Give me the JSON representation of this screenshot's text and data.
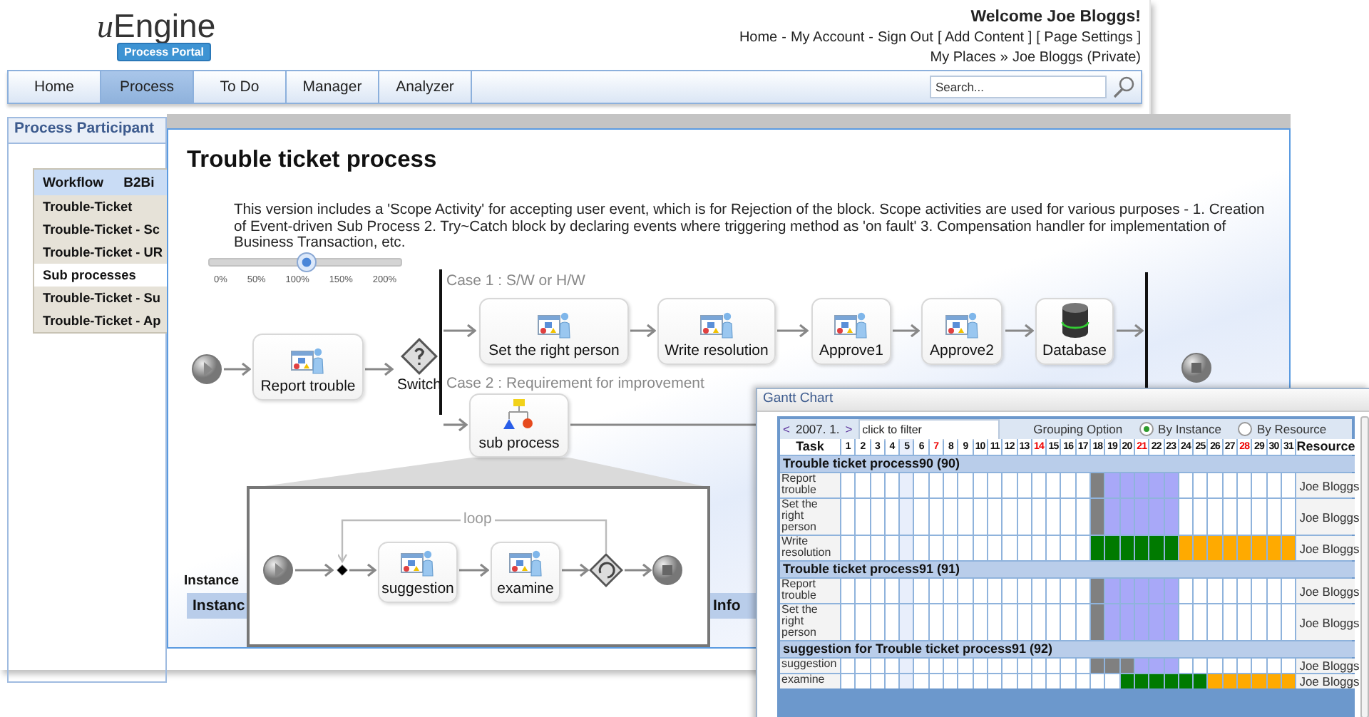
{
  "portal": {
    "logo": {
      "mark": "u",
      "name": "Engine",
      "badge": "Process Portal"
    },
    "welcome": "Welcome Joe Bloggs!",
    "links": [
      {
        "label": "Home",
        "separator": "-"
      },
      {
        "label": "My Account",
        "separator": "-"
      },
      {
        "label": "Sign Out"
      },
      {
        "label": "[ Add Content ]"
      },
      {
        "label": "[ Page Settings ]"
      }
    ],
    "breadcrumb": {
      "items": [
        "My Places",
        "Joe Bloggs (Private)"
      ],
      "separator": "»"
    },
    "nav": [
      {
        "label": "Home",
        "selected": false
      },
      {
        "label": "Process",
        "selected": true
      },
      {
        "label": "To Do",
        "selected": false
      },
      {
        "label": "Manager",
        "selected": false
      },
      {
        "label": "Analyzer",
        "selected": false
      }
    ],
    "search": {
      "placeholder": "Search..."
    },
    "panel": {
      "title": "Process Participant",
      "columns": [
        "Workflow",
        "B2Bi"
      ],
      "items": [
        {
          "label": "Trouble-Ticket",
          "kind": "item"
        },
        {
          "label": "Trouble-Ticket - Sc",
          "kind": "item"
        },
        {
          "label": "Trouble-Ticket - UR",
          "kind": "item"
        },
        {
          "label": "Sub processes",
          "kind": "group"
        },
        {
          "label": "Trouble-Ticket - Su",
          "kind": "item"
        },
        {
          "label": "Trouble-Ticket - Ap",
          "kind": "item"
        }
      ]
    }
  },
  "process": {
    "title": "Trouble ticket process",
    "description": "This version includes a 'Scope Activity' for accepting user event, which is for Rejection of the block. Scope activities are used for various purposes - 1. Creation of Event-driven Sub Process 2. Try~Catch block by declaring events where triggering method as 'on fault' 3. Compensation handler for implementation of Business Transaction, etc.",
    "zoom": {
      "level": 0.5,
      "marks": [
        "0%",
        "50%",
        "100%",
        "150%",
        "200%"
      ]
    },
    "cases": [
      "Case 1 : S/W or H/W",
      "Case 2 : Requirement for improvement"
    ],
    "nodes": [
      {
        "kind": "start"
      },
      {
        "kind": "task",
        "label": "Report trouble"
      },
      {
        "kind": "switch",
        "label": "Switch"
      },
      {
        "kind": "task",
        "label": "Set the right person"
      },
      {
        "kind": "task",
        "label": "Write resolution"
      },
      {
        "kind": "task",
        "label": "Approve1"
      },
      {
        "kind": "task",
        "label": "Approve2"
      },
      {
        "kind": "database",
        "label": "Database"
      },
      {
        "kind": "end"
      },
      {
        "kind": "subprocess",
        "label": "sub process"
      }
    ],
    "subprocess": {
      "loop": "loop",
      "nodes": [
        {
          "kind": "start"
        },
        {
          "kind": "join"
        },
        {
          "kind": "task",
          "label": "suggestion"
        },
        {
          "kind": "task",
          "label": "examine"
        },
        {
          "kind": "loop"
        },
        {
          "kind": "end"
        }
      ]
    },
    "instances": {
      "title": "Instance",
      "columns": [
        "Instanc",
        "Info"
      ]
    }
  },
  "gantt": {
    "title": "Gantt Chart",
    "prev": "<",
    "month": "2007. 1.",
    "next": ">",
    "filter": {
      "placeholder": "click to filter"
    },
    "grouping": {
      "label": "Grouping Option",
      "options": [
        {
          "label": "By Instance",
          "selected": true
        },
        {
          "label": "By Resource",
          "selected": false
        }
      ]
    },
    "task_header": "Task",
    "resource_header": "Resource",
    "days": [
      {
        "label": "1",
        "holiday": false,
        "today": false
      },
      {
        "label": "2",
        "holiday": false,
        "today": false
      },
      {
        "label": "3",
        "holiday": false,
        "today": false
      },
      {
        "label": "4",
        "holiday": false,
        "today": false
      },
      {
        "label": "5",
        "holiday": false,
        "today": true
      },
      {
        "label": "6",
        "holiday": false,
        "today": false
      },
      {
        "label": "7",
        "holiday": true,
        "today": false
      },
      {
        "label": "8",
        "holiday": false,
        "today": false
      },
      {
        "label": "9",
        "holiday": false,
        "today": false
      },
      {
        "label": "10",
        "holiday": false,
        "today": false
      },
      {
        "label": "11",
        "holiday": false,
        "today": false
      },
      {
        "label": "12",
        "holiday": false,
        "today": false
      },
      {
        "label": "13",
        "holiday": false,
        "today": false
      },
      {
        "label": "14",
        "holiday": true,
        "today": false
      },
      {
        "label": "15",
        "holiday": false,
        "today": false
      },
      {
        "label": "16",
        "holiday": false,
        "today": false
      },
      {
        "label": "17",
        "holiday": false,
        "today": false
      },
      {
        "label": "18",
        "holiday": false,
        "today": false
      },
      {
        "label": "19",
        "holiday": false,
        "today": false
      },
      {
        "label": "20",
        "holiday": false,
        "today": false
      },
      {
        "label": "21",
        "holiday": true,
        "today": false
      },
      {
        "label": "22",
        "holiday": false,
        "today": false
      },
      {
        "label": "23",
        "holiday": false,
        "today": false
      },
      {
        "label": "24",
        "holiday": false,
        "today": false
      },
      {
        "label": "25",
        "holiday": false,
        "today": false
      },
      {
        "label": "26",
        "holiday": false,
        "today": false
      },
      {
        "label": "27",
        "holiday": false,
        "today": false
      },
      {
        "label": "28",
        "holiday": true,
        "today": false
      },
      {
        "label": "29",
        "holiday": false,
        "today": false
      },
      {
        "label": "30",
        "holiday": false,
        "today": false
      },
      {
        "label": "31",
        "holiday": false,
        "today": false
      }
    ],
    "groups": [
      {
        "title": "Trouble ticket process90 (90)",
        "tasks": [
          {
            "name": "Report trouble",
            "cells": [
              {
                "kind": "empty"
              },
              {
                "kind": "empty"
              },
              {
                "kind": "empty"
              },
              {
                "kind": "empty"
              },
              {
                "kind": "empty"
              },
              {
                "kind": "empty"
              },
              {
                "kind": "empty"
              },
              {
                "kind": "empty"
              },
              {
                "kind": "empty"
              },
              {
                "kind": "empty"
              },
              {
                "kind": "empty"
              },
              {
                "kind": "empty"
              },
              {
                "kind": "empty"
              },
              {
                "kind": "empty"
              },
              {
                "kind": "empty"
              },
              {
                "kind": "empty"
              },
              {
                "kind": "empty"
              },
              {
                "kind": "bar",
                "color": "#808080"
              },
              {
                "kind": "bar",
                "color": "#a8a8f8"
              },
              {
                "kind": "bar",
                "color": "#a8a8f8"
              },
              {
                "kind": "bar",
                "color": "#a8a8f8"
              },
              {
                "kind": "bar",
                "color": "#a8a8f8"
              },
              {
                "kind": "bar",
                "color": "#a8a8f8"
              },
              {
                "kind": "empty"
              },
              {
                "kind": "empty"
              },
              {
                "kind": "empty"
              },
              {
                "kind": "empty"
              },
              {
                "kind": "empty"
              },
              {
                "kind": "empty"
              },
              {
                "kind": "empty"
              },
              {
                "kind": "empty"
              }
            ],
            "resource": "Joe Bloggs"
          },
          {
            "name": "Set the right person",
            "cells": [
              {
                "kind": "empty"
              },
              {
                "kind": "empty"
              },
              {
                "kind": "empty"
              },
              {
                "kind": "empty"
              },
              {
                "kind": "empty"
              },
              {
                "kind": "empty"
              },
              {
                "kind": "empty"
              },
              {
                "kind": "empty"
              },
              {
                "kind": "empty"
              },
              {
                "kind": "empty"
              },
              {
                "kind": "empty"
              },
              {
                "kind": "empty"
              },
              {
                "kind": "empty"
              },
              {
                "kind": "empty"
              },
              {
                "kind": "empty"
              },
              {
                "kind": "empty"
              },
              {
                "kind": "empty"
              },
              {
                "kind": "bar",
                "color": "#808080"
              },
              {
                "kind": "bar",
                "color": "#a8a8f8"
              },
              {
                "kind": "bar",
                "color": "#a8a8f8"
              },
              {
                "kind": "bar",
                "color": "#a8a8f8"
              },
              {
                "kind": "bar",
                "color": "#a8a8f8"
              },
              {
                "kind": "bar",
                "color": "#a8a8f8"
              },
              {
                "kind": "empty"
              },
              {
                "kind": "empty"
              },
              {
                "kind": "empty"
              },
              {
                "kind": "empty"
              },
              {
                "kind": "empty"
              },
              {
                "kind": "empty"
              },
              {
                "kind": "empty"
              },
              {
                "kind": "empty"
              }
            ],
            "resource": "Joe Bloggs"
          },
          {
            "name": "Write resolution",
            "cells": [
              {
                "kind": "empty"
              },
              {
                "kind": "empty"
              },
              {
                "kind": "empty"
              },
              {
                "kind": "empty"
              },
              {
                "kind": "empty"
              },
              {
                "kind": "empty"
              },
              {
                "kind": "empty"
              },
              {
                "kind": "empty"
              },
              {
                "kind": "empty"
              },
              {
                "kind": "empty"
              },
              {
                "kind": "empty"
              },
              {
                "kind": "empty"
              },
              {
                "kind": "empty"
              },
              {
                "kind": "empty"
              },
              {
                "kind": "empty"
              },
              {
                "kind": "empty"
              },
              {
                "kind": "empty"
              },
              {
                "kind": "bar",
                "color": "#007a00"
              },
              {
                "kind": "bar",
                "color": "#007a00"
              },
              {
                "kind": "bar",
                "color": "#007a00"
              },
              {
                "kind": "bar",
                "color": "#007a00"
              },
              {
                "kind": "bar",
                "color": "#007a00"
              },
              {
                "kind": "bar",
                "color": "#007a00"
              },
              {
                "kind": "bar",
                "color": "#ffaa00"
              },
              {
                "kind": "bar",
                "color": "#ffaa00"
              },
              {
                "kind": "bar",
                "color": "#ffaa00"
              },
              {
                "kind": "bar",
                "color": "#ffaa00"
              },
              {
                "kind": "bar",
                "color": "#ffaa00"
              },
              {
                "kind": "bar",
                "color": "#ffaa00"
              },
              {
                "kind": "bar",
                "color": "#ffaa00"
              },
              {
                "kind": "bar",
                "color": "#ffaa00"
              }
            ],
            "resource": "Joe Bloggs"
          }
        ]
      },
      {
        "title": "Trouble ticket process91 (91)",
        "tasks": [
          {
            "name": "Report trouble",
            "cells": [
              {
                "kind": "empty"
              },
              {
                "kind": "empty"
              },
              {
                "kind": "empty"
              },
              {
                "kind": "empty"
              },
              {
                "kind": "empty"
              },
              {
                "kind": "empty"
              },
              {
                "kind": "empty"
              },
              {
                "kind": "empty"
              },
              {
                "kind": "empty"
              },
              {
                "kind": "empty"
              },
              {
                "kind": "empty"
              },
              {
                "kind": "empty"
              },
              {
                "kind": "empty"
              },
              {
                "kind": "empty"
              },
              {
                "kind": "empty"
              },
              {
                "kind": "empty"
              },
              {
                "kind": "empty"
              },
              {
                "kind": "bar",
                "color": "#808080"
              },
              {
                "kind": "bar",
                "color": "#a8a8f8"
              },
              {
                "kind": "bar",
                "color": "#a8a8f8"
              },
              {
                "kind": "bar",
                "color": "#a8a8f8"
              },
              {
                "kind": "bar",
                "color": "#a8a8f8"
              },
              {
                "kind": "bar",
                "color": "#a8a8f8"
              },
              {
                "kind": "empty"
              },
              {
                "kind": "empty"
              },
              {
                "kind": "empty"
              },
              {
                "kind": "empty"
              },
              {
                "kind": "empty"
              },
              {
                "kind": "empty"
              },
              {
                "kind": "empty"
              },
              {
                "kind": "empty"
              }
            ],
            "resource": "Joe Bloggs"
          },
          {
            "name": "Set the right person",
            "cells": [
              {
                "kind": "empty"
              },
              {
                "kind": "empty"
              },
              {
                "kind": "empty"
              },
              {
                "kind": "empty"
              },
              {
                "kind": "empty"
              },
              {
                "kind": "empty"
              },
              {
                "kind": "empty"
              },
              {
                "kind": "empty"
              },
              {
                "kind": "empty"
              },
              {
                "kind": "empty"
              },
              {
                "kind": "empty"
              },
              {
                "kind": "empty"
              },
              {
                "kind": "empty"
              },
              {
                "kind": "empty"
              },
              {
                "kind": "empty"
              },
              {
                "kind": "empty"
              },
              {
                "kind": "empty"
              },
              {
                "kind": "bar",
                "color": "#808080"
              },
              {
                "kind": "bar",
                "color": "#a8a8f8"
              },
              {
                "kind": "bar",
                "color": "#a8a8f8"
              },
              {
                "kind": "bar",
                "color": "#a8a8f8"
              },
              {
                "kind": "bar",
                "color": "#a8a8f8"
              },
              {
                "kind": "bar",
                "color": "#a8a8f8"
              },
              {
                "kind": "empty"
              },
              {
                "kind": "empty"
              },
              {
                "kind": "empty"
              },
              {
                "kind": "empty"
              },
              {
                "kind": "empty"
              },
              {
                "kind": "empty"
              },
              {
                "kind": "empty"
              },
              {
                "kind": "empty"
              }
            ],
            "resource": "Joe Bloggs"
          }
        ]
      },
      {
        "title": "suggestion for Trouble ticket process91 (92)",
        "tasks": [
          {
            "name": "suggestion",
            "cells": [
              {
                "kind": "empty"
              },
              {
                "kind": "empty"
              },
              {
                "kind": "empty"
              },
              {
                "kind": "empty"
              },
              {
                "kind": "empty"
              },
              {
                "kind": "empty"
              },
              {
                "kind": "empty"
              },
              {
                "kind": "empty"
              },
              {
                "kind": "empty"
              },
              {
                "kind": "empty"
              },
              {
                "kind": "empty"
              },
              {
                "kind": "empty"
              },
              {
                "kind": "empty"
              },
              {
                "kind": "empty"
              },
              {
                "kind": "empty"
              },
              {
                "kind": "empty"
              },
              {
                "kind": "empty"
              },
              {
                "kind": "bar",
                "color": "#808080"
              },
              {
                "kind": "bar",
                "color": "#808080"
              },
              {
                "kind": "bar",
                "color": "#808080"
              },
              {
                "kind": "bar",
                "color": "#a8a8f8"
              },
              {
                "kind": "bar",
                "color": "#a8a8f8"
              },
              {
                "kind": "bar",
                "color": "#a8a8f8"
              },
              {
                "kind": "empty"
              },
              {
                "kind": "empty"
              },
              {
                "kind": "empty"
              },
              {
                "kind": "empty"
              },
              {
                "kind": "empty"
              },
              {
                "kind": "empty"
              },
              {
                "kind": "empty"
              },
              {
                "kind": "empty"
              }
            ],
            "resource": "Joe Bloggs"
          },
          {
            "name": "examine",
            "cells": [
              {
                "kind": "empty"
              },
              {
                "kind": "empty"
              },
              {
                "kind": "empty"
              },
              {
                "kind": "empty"
              },
              {
                "kind": "empty"
              },
              {
                "kind": "empty"
              },
              {
                "kind": "empty"
              },
              {
                "kind": "empty"
              },
              {
                "kind": "empty"
              },
              {
                "kind": "empty"
              },
              {
                "kind": "empty"
              },
              {
                "kind": "empty"
              },
              {
                "kind": "empty"
              },
              {
                "kind": "empty"
              },
              {
                "kind": "empty"
              },
              {
                "kind": "empty"
              },
              {
                "kind": "empty"
              },
              {
                "kind": "empty"
              },
              {
                "kind": "empty"
              },
              {
                "kind": "bar",
                "color": "#007a00"
              },
              {
                "kind": "bar",
                "color": "#007a00"
              },
              {
                "kind": "bar",
                "color": "#007a00"
              },
              {
                "kind": "bar",
                "color": "#007a00"
              },
              {
                "kind": "bar",
                "color": "#007a00"
              },
              {
                "kind": "bar",
                "color": "#007a00"
              },
              {
                "kind": "bar",
                "color": "#ffaa00"
              },
              {
                "kind": "bar",
                "color": "#ffaa00"
              },
              {
                "kind": "bar",
                "color": "#ffaa00"
              },
              {
                "kind": "bar",
                "color": "#ffaa00"
              },
              {
                "kind": "bar",
                "color": "#ffaa00"
              },
              {
                "kind": "bar",
                "color": "#ffaa00"
              }
            ],
            "resource": "Joe Bloggs"
          }
        ]
      }
    ]
  }
}
